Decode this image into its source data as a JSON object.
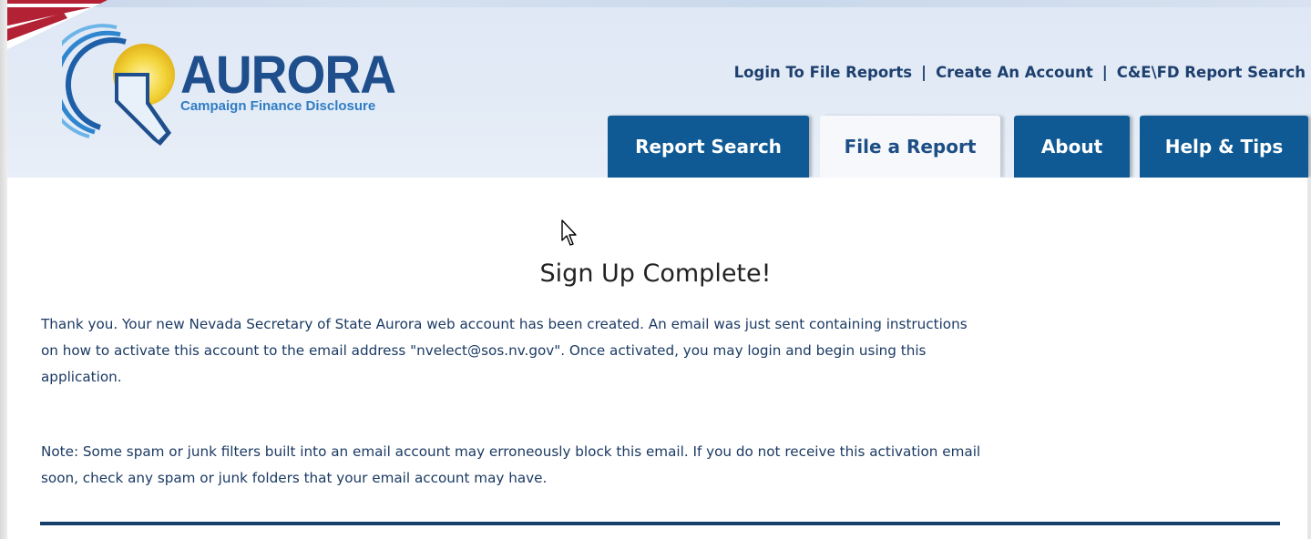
{
  "logo": {
    "title": "AURORA",
    "subtitle": "Campaign Finance Disclosure"
  },
  "toplinks": {
    "items": [
      {
        "label": "Login To File Reports"
      },
      {
        "label": "Create An Account"
      },
      {
        "label": "C&E\\FD Report Search"
      }
    ],
    "separator": "|"
  },
  "tabs": [
    {
      "label": "Report Search",
      "active": false
    },
    {
      "label": "File a Report",
      "active": true
    },
    {
      "label": "About",
      "active": false
    },
    {
      "label": "Help & Tips",
      "active": false
    }
  ],
  "main": {
    "title": "Sign Up Complete!",
    "paragraph1_line1": "Thank you.  Your new Nevada Secretary of State Aurora web account has been created.  An email was just sent containing instructions",
    "paragraph1_line2": "on how to activate this account to the email address \"nvelect@sos.nv.gov\".  Once activated, you may login and begin using this",
    "paragraph1_line3": "application.",
    "paragraph2_line1": "Note: Some spam or junk filters built into an email account may erroneously block this email.  If you do not receive this activation email",
    "paragraph2_line2": "soon, check any spam or junk folders that your email account may have."
  },
  "colors": {
    "tab_bg": "#0f5a94",
    "tab_active_bg": "#f6f8fb",
    "header_bg": "#e3ebf6",
    "logo_blue": "#1f4e8c",
    "text_blue": "#1b3a63",
    "rule": "#163f6b"
  },
  "icons": {
    "logo": "nevada-sunrise-logo",
    "flag": "american-flag-corner",
    "cursor": "mouse-pointer-icon"
  }
}
